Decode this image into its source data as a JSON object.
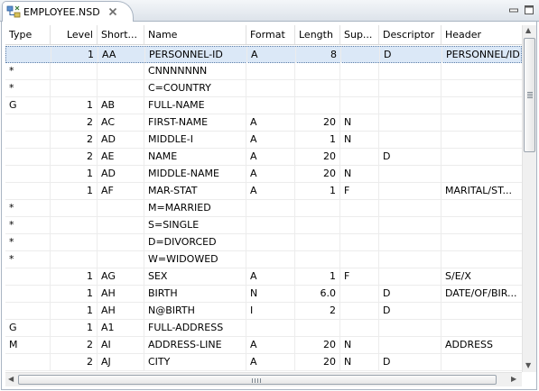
{
  "tab": {
    "title": "EMPLOYEE.NSD",
    "icon": "ddm-file-icon"
  },
  "window_buttons": {
    "minimize": "minimize-icon",
    "maximize": "maximize-icon"
  },
  "table": {
    "columns": [
      "Type",
      "Level",
      "Short...",
      "Name",
      "Format",
      "Length",
      "Sup...",
      "Descriptor",
      "Header"
    ],
    "rows": [
      {
        "type": "",
        "level": "1",
        "short": "AA",
        "name": "PERSONNEL-ID",
        "format": "A",
        "length": "8",
        "sup": "",
        "descriptor": "D",
        "header": "PERSONNEL/ID"
      },
      {
        "type": "*",
        "level": "",
        "short": "",
        "name": "CNNNNNNN",
        "format": "",
        "length": "",
        "sup": "",
        "descriptor": "",
        "header": ""
      },
      {
        "type": "*",
        "level": "",
        "short": "",
        "name": "C=COUNTRY",
        "format": "",
        "length": "",
        "sup": "",
        "descriptor": "",
        "header": ""
      },
      {
        "type": "G",
        "level": "1",
        "short": "AB",
        "name": "FULL-NAME",
        "format": "",
        "length": "",
        "sup": "",
        "descriptor": "",
        "header": ""
      },
      {
        "type": "",
        "level": "2",
        "short": "AC",
        "name": "FIRST-NAME",
        "format": "A",
        "length": "20",
        "sup": "N",
        "descriptor": "",
        "header": ""
      },
      {
        "type": "",
        "level": "2",
        "short": "AD",
        "name": "MIDDLE-I",
        "format": "A",
        "length": "1",
        "sup": "N",
        "descriptor": "",
        "header": ""
      },
      {
        "type": "",
        "level": "2",
        "short": "AE",
        "name": "NAME",
        "format": "A",
        "length": "20",
        "sup": "",
        "descriptor": "D",
        "header": ""
      },
      {
        "type": "",
        "level": "1",
        "short": "AD",
        "name": "MIDDLE-NAME",
        "format": "A",
        "length": "20",
        "sup": "N",
        "descriptor": "",
        "header": ""
      },
      {
        "type": "",
        "level": "1",
        "short": "AF",
        "name": "MAR-STAT",
        "format": "A",
        "length": "1",
        "sup": "F",
        "descriptor": "",
        "header": "MARITAL/ST..."
      },
      {
        "type": "*",
        "level": "",
        "short": "",
        "name": "M=MARRIED",
        "format": "",
        "length": "",
        "sup": "",
        "descriptor": "",
        "header": ""
      },
      {
        "type": "*",
        "level": "",
        "short": "",
        "name": "S=SINGLE",
        "format": "",
        "length": "",
        "sup": "",
        "descriptor": "",
        "header": ""
      },
      {
        "type": "*",
        "level": "",
        "short": "",
        "name": "D=DIVORCED",
        "format": "",
        "length": "",
        "sup": "",
        "descriptor": "",
        "header": ""
      },
      {
        "type": "*",
        "level": "",
        "short": "",
        "name": "W=WIDOWED",
        "format": "",
        "length": "",
        "sup": "",
        "descriptor": "",
        "header": ""
      },
      {
        "type": "",
        "level": "1",
        "short": "AG",
        "name": "SEX",
        "format": "A",
        "length": "1",
        "sup": "F",
        "descriptor": "",
        "header": "S/E/X"
      },
      {
        "type": "",
        "level": "1",
        "short": "AH",
        "name": "BIRTH",
        "format": "N",
        "length": "6.0",
        "sup": "",
        "descriptor": "D",
        "header": "DATE/OF/BIR..."
      },
      {
        "type": "",
        "level": "1",
        "short": "AH",
        "name": "N@BIRTH",
        "format": "I",
        "length": "2",
        "sup": "",
        "descriptor": "D",
        "header": ""
      },
      {
        "type": "G",
        "level": "1",
        "short": "A1",
        "name": "FULL-ADDRESS",
        "format": "",
        "length": "",
        "sup": "",
        "descriptor": "",
        "header": ""
      },
      {
        "type": "M",
        "level": "2",
        "short": "AI",
        "name": "ADDRESS-LINE",
        "format": "A",
        "length": "20",
        "sup": "N",
        "descriptor": "",
        "header": "ADDRESS"
      },
      {
        "type": "",
        "level": "2",
        "short": "AJ",
        "name": "CITY",
        "format": "A",
        "length": "20",
        "sup": "N",
        "descriptor": "D",
        "header": ""
      }
    ]
  }
}
